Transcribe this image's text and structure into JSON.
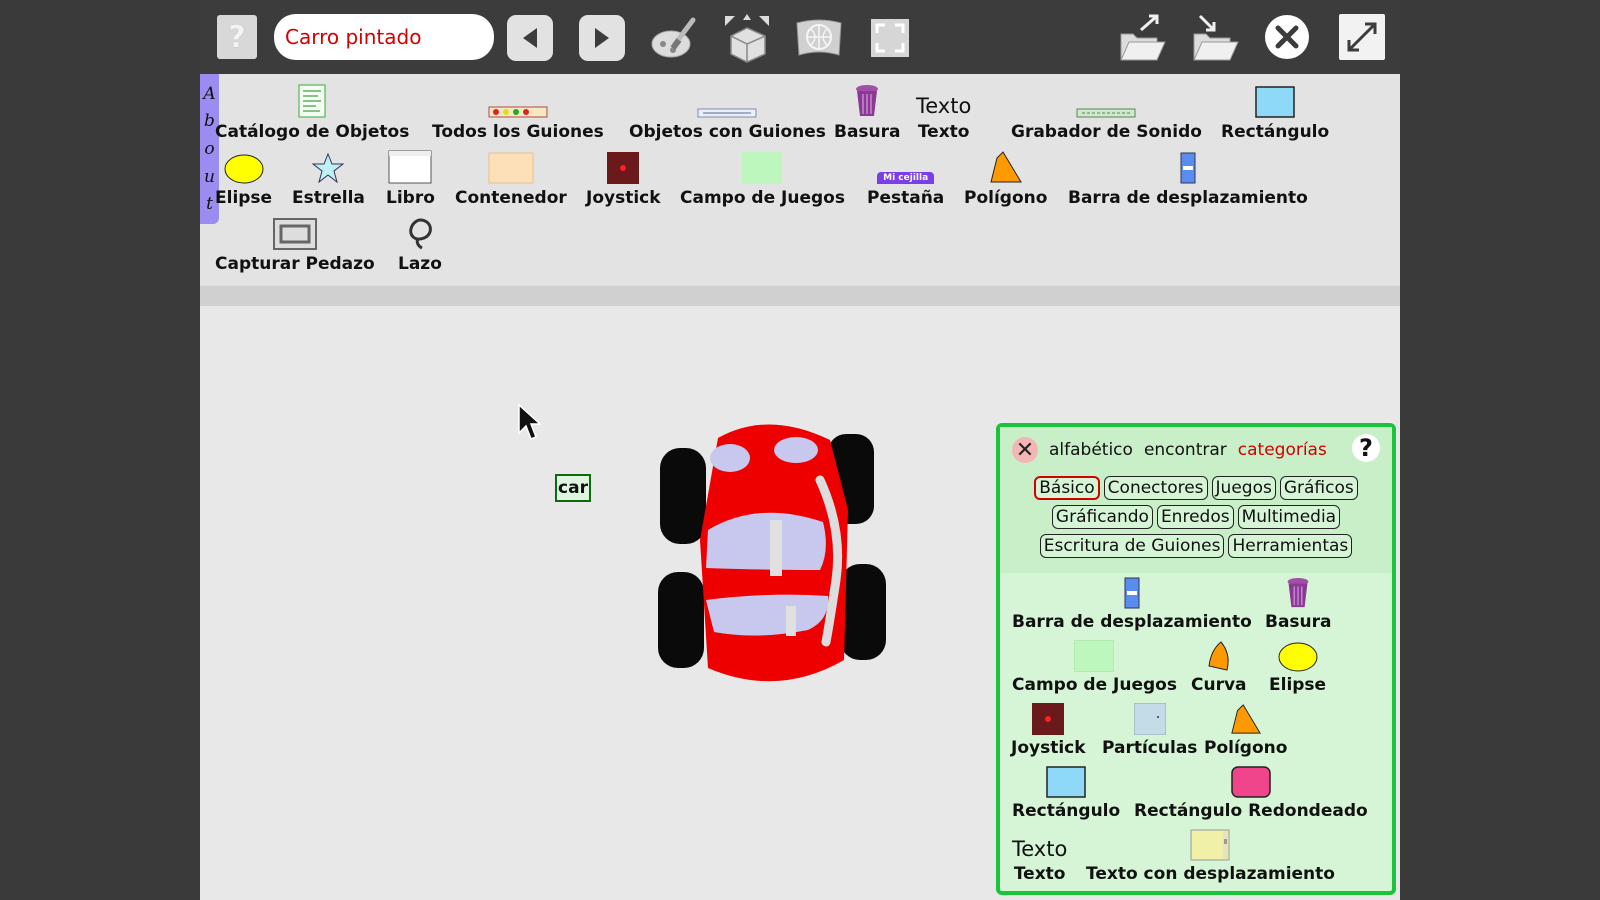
{
  "toolbar": {
    "help_glyph": "?",
    "project_title": "Carro pintado",
    "icons": [
      "back-arrow-icon",
      "forward-arrow-icon",
      "paint-icon",
      "supplies-icon",
      "world-icon",
      "fullscreen-frame-icon",
      "load-icon",
      "save-icon",
      "close-icon",
      "expand-icon"
    ]
  },
  "about_tab": {
    "letters": [
      "A",
      "b",
      "o",
      "u",
      "t"
    ]
  },
  "supplies": {
    "items": [
      {
        "label": "Catálogo de Objetos"
      },
      {
        "label": "Todos los Guiones"
      },
      {
        "label": "Objetos con Guiones"
      },
      {
        "label": "Basura"
      },
      {
        "label": "Texto",
        "icon_text": "Texto"
      },
      {
        "label": "Grabador de Sonido"
      },
      {
        "label": "Rectángulo"
      },
      {
        "label": "Elipse"
      },
      {
        "label": "Estrella"
      },
      {
        "label": "Libro"
      },
      {
        "label": "Contenedor"
      },
      {
        "label": "Joystick"
      },
      {
        "label": "Campo de Juegos"
      },
      {
        "label": "Pestaña",
        "icon_text": "Mi cejilla"
      },
      {
        "label": "Polígono"
      },
      {
        "label": "Barra de desplazamiento"
      },
      {
        "label": "Capturar Pedazo"
      },
      {
        "label": "Lazo"
      }
    ]
  },
  "world": {
    "car_label": "car"
  },
  "catalog": {
    "close_glyph": "✕",
    "modes": [
      "alfabético",
      "encontrar",
      "categorías"
    ],
    "active_mode": "categorías",
    "help_glyph": "?",
    "tabs": [
      "Básico",
      "Conectores",
      "Juegos",
      "Gráficos",
      "Gráficando",
      "Enredos",
      "Multimedia",
      "Escritura de Guiones",
      "Herramientas"
    ],
    "active_tab": "Básico",
    "items": [
      {
        "label": "Barra de desplazamiento"
      },
      {
        "label": "Basura"
      },
      {
        "label": "Campo de Juegos"
      },
      {
        "label": "Curva"
      },
      {
        "label": "Elipse"
      },
      {
        "label": "Joystick"
      },
      {
        "label": "Partículas"
      },
      {
        "label": "Polígono"
      },
      {
        "label": "Rectángulo"
      },
      {
        "label": "Rectángulo Redondeado"
      },
      {
        "label": "Texto",
        "icon_text": "Texto"
      },
      {
        "label": "Texto con desplazamiento"
      }
    ]
  },
  "colors": {
    "accent_red": "#d40000",
    "catalog_border": "#19c33a",
    "about_tab": "#9a8cf0",
    "car_body": "#ee0000"
  }
}
